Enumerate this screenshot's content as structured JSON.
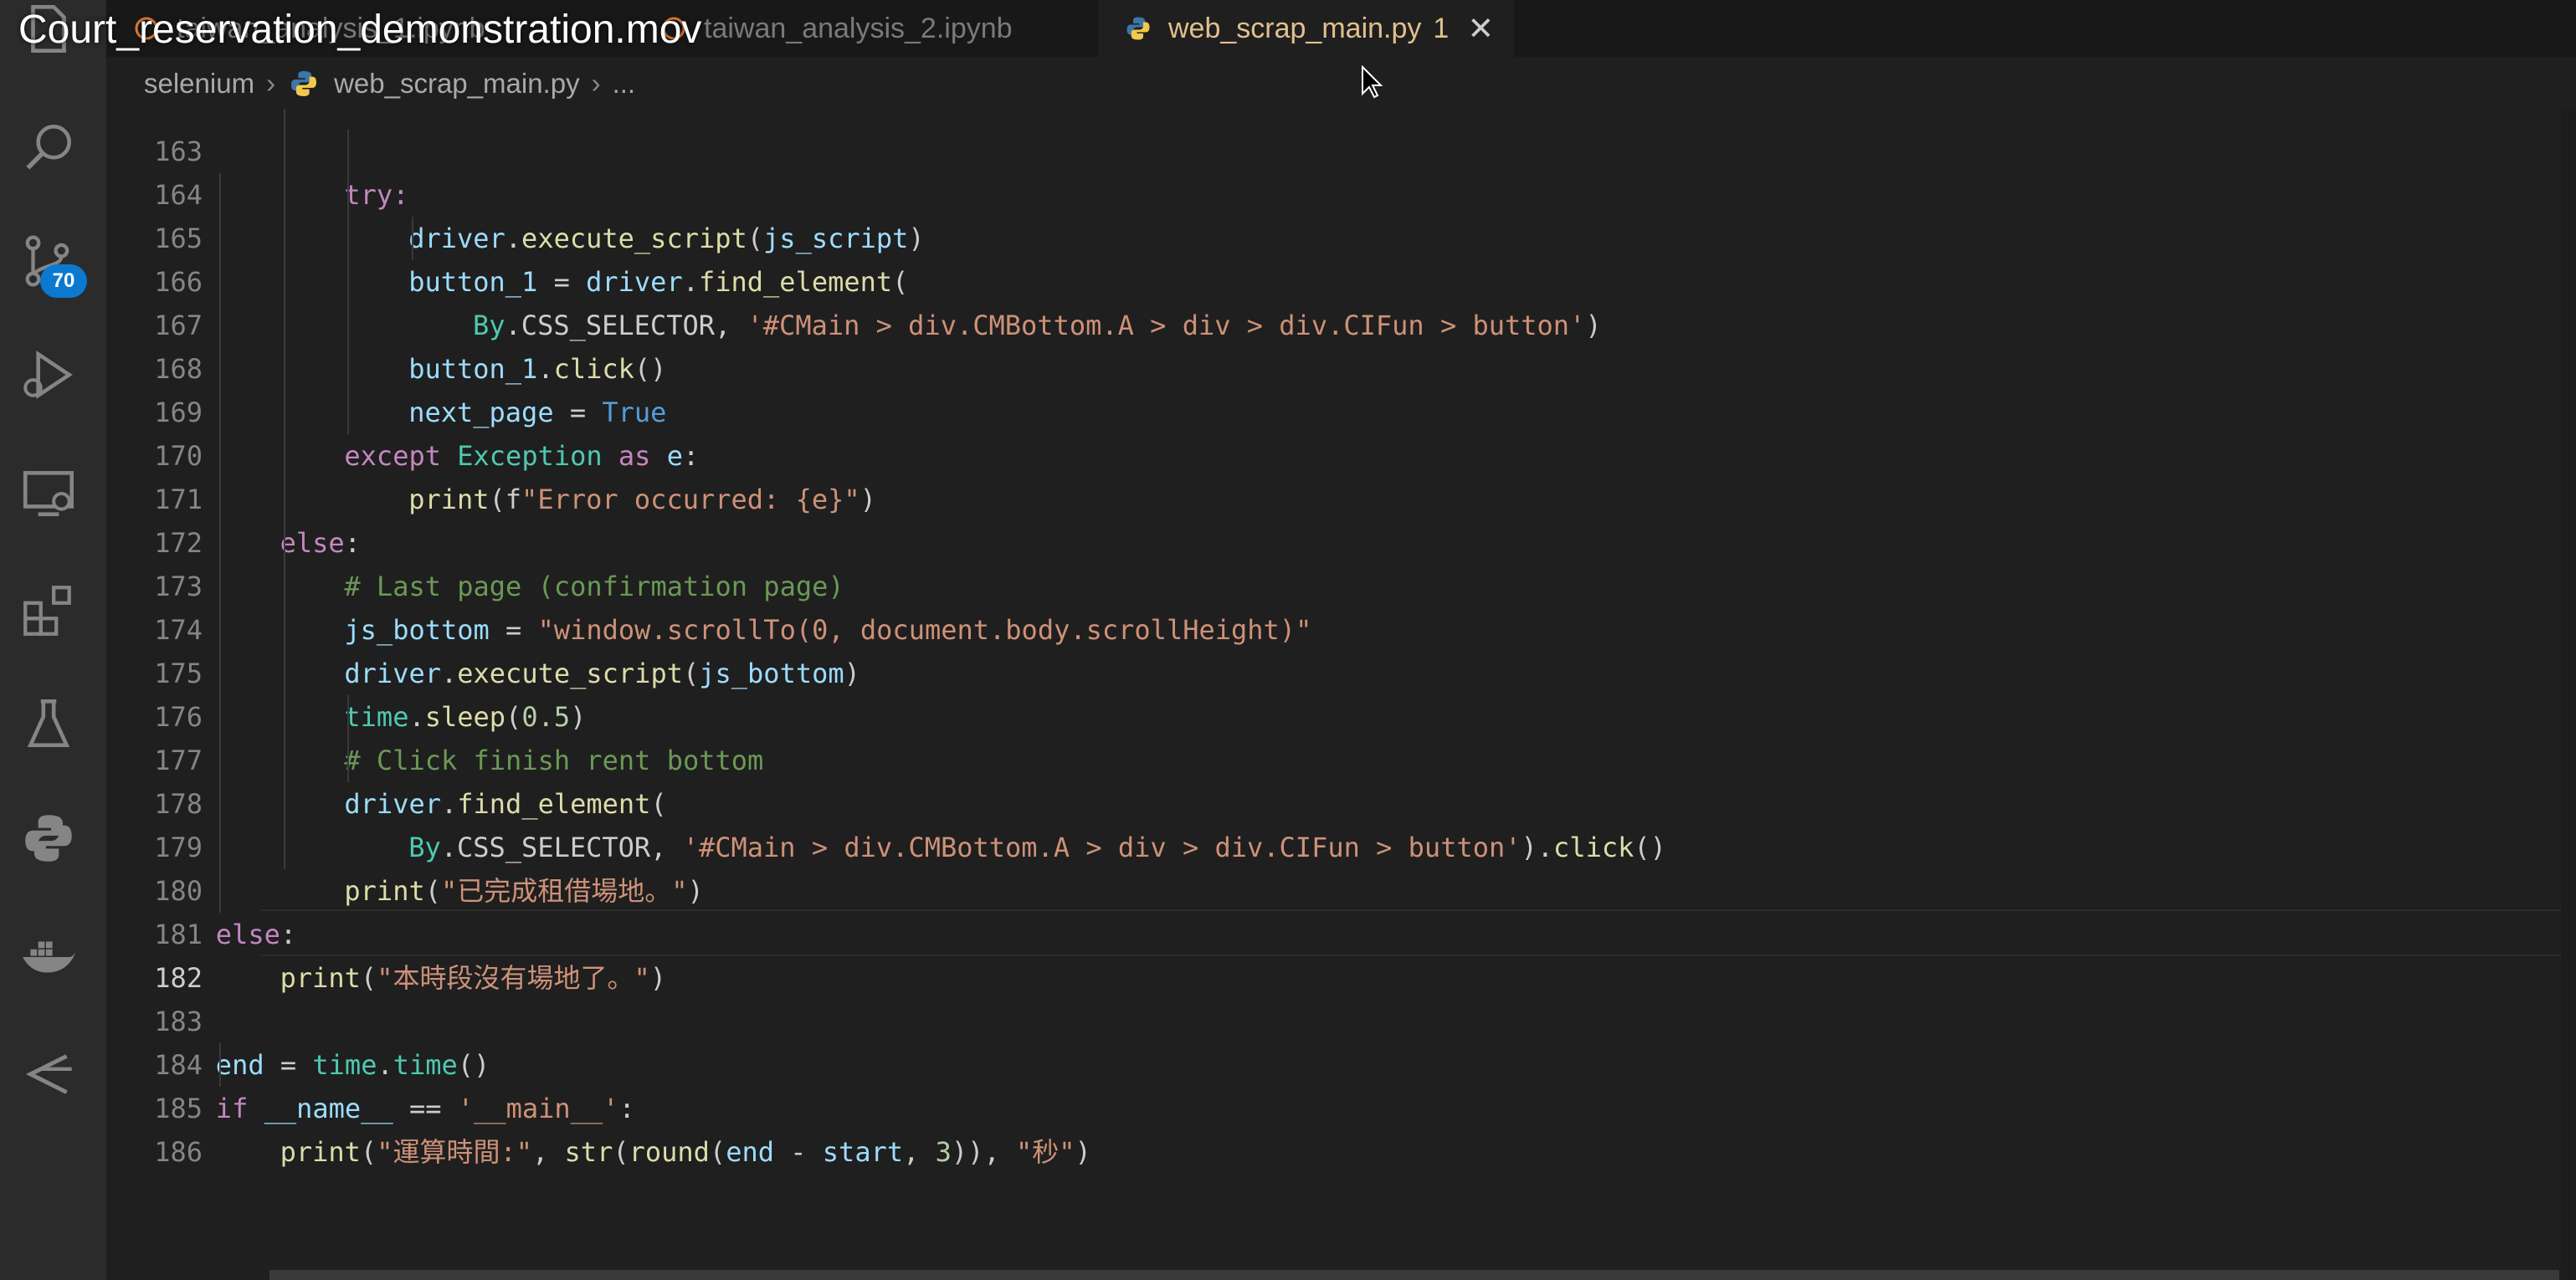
{
  "video_title": "Court_reservation_demonstration.mov",
  "tabs": [
    {
      "label": "taiwan_analysis_1.ipynb",
      "active": false
    },
    {
      "label": "taiwan_analysis_2.ipynb",
      "active": false
    },
    {
      "label": "web_scrap_main.py",
      "problems": "1",
      "active": true
    }
  ],
  "breadcrumb": {
    "folder": "selenium",
    "file": "web_scrap_main.py",
    "more": "..."
  },
  "scm_badge": "70",
  "activity_icons": [
    "files-icon",
    "search-icon",
    "source-control-icon",
    "run-debug-icon",
    "remote-explorer-icon",
    "extensions-icon",
    "testing-icon",
    "python-icon",
    "docker-icon",
    "gitlens-icon"
  ],
  "current_line": "182",
  "code_lines": [
    {
      "n": "163",
      "t": "try:"
    },
    {
      "n": "164",
      "t": "driver.execute_script(js_script)"
    },
    {
      "n": "165",
      "t": "button_1 = driver.find_element("
    },
    {
      "n": "166",
      "t": "By.CSS_SELECTOR, '#CMain > div.CMBottom.A > div > div.CIFun > button')"
    },
    {
      "n": "167",
      "t": "button_1.click()"
    },
    {
      "n": "168",
      "t": "next_page = True"
    },
    {
      "n": "169",
      "t": "except Exception as e:"
    },
    {
      "n": "170",
      "t": "print(f\"Error occurred: {e}\")"
    },
    {
      "n": "171",
      "t": "else:"
    },
    {
      "n": "172",
      "t": "# Last page (confirmation page)"
    },
    {
      "n": "173",
      "t": "js_bottom = \"window.scrollTo(0, document.body.scrollHeight)\""
    },
    {
      "n": "174",
      "t": "driver.execute_script(js_bottom)"
    },
    {
      "n": "175",
      "t": "time.sleep(0.5)"
    },
    {
      "n": "176",
      "t": "# Click finish rent bottom"
    },
    {
      "n": "177",
      "t": "driver.find_element("
    },
    {
      "n": "178",
      "t": "By.CSS_SELECTOR, '#CMain > div.CMBottom.A > div > div.CIFun > button').click()"
    },
    {
      "n": "179",
      "t": "print(\"已完成租借場地。\")"
    },
    {
      "n": "180",
      "t": "else:"
    },
    {
      "n": "181",
      "t": "print(\"本時段沒有場地了。\")"
    },
    {
      "n": "182",
      "t": ""
    },
    {
      "n": "183",
      "t": "end = time.time()"
    },
    {
      "n": "184",
      "t": "if __name__ == '__main__':"
    },
    {
      "n": "185",
      "t": "print(\"運算時間:\", str(round(end - start, 3)), \"秒\")"
    },
    {
      "n": "186",
      "t": ""
    }
  ],
  "colors": {
    "keyword": "#c586c0",
    "builtin": "#569cd6",
    "variable": "#9cdcfe",
    "function": "#dcdcaa",
    "string": "#ce9178",
    "comment": "#6a9955",
    "type": "#4ec9b0",
    "number": "#b5cea8",
    "active_tab_text": "#e2c08d",
    "badge": "#0b79d0"
  }
}
